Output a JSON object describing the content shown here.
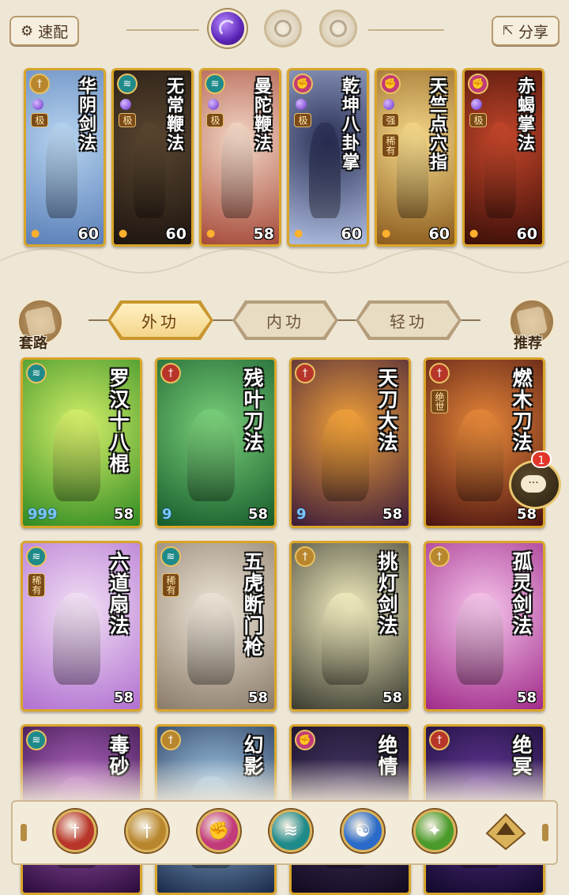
{
  "top_bar": {
    "quick_label": "速配",
    "share_label": "分享"
  },
  "equipped": [
    {
      "title": "华阴剑法",
      "level": "60",
      "grade": "极",
      "bg": [
        "#b7d4f0",
        "#5a7fb8"
      ],
      "school_color": "#b8862c",
      "school_glyph": "†"
    },
    {
      "title": "无常鞭法",
      "level": "60",
      "grade": "极",
      "bg": [
        "#5a4630",
        "#1e1510"
      ],
      "school_color": "#1f8a8a",
      "school_glyph": "≋"
    },
    {
      "title": "曼陀鞭法",
      "level": "58",
      "grade": "极",
      "bg": [
        "#f3d7c6",
        "#a64a3a"
      ],
      "school_color": "#1f8a8a",
      "school_glyph": "≋"
    },
    {
      "title": "乾坤八卦掌",
      "level": "60",
      "grade": "极",
      "bg": [
        "#2a2f55",
        "#aebde0"
      ],
      "school_color": "#c23a7a",
      "school_glyph": "✊"
    },
    {
      "title": "天竺点穴指",
      "level": "60",
      "grade": "强",
      "rarity": "稀有",
      "bg": [
        "#f6d98a",
        "#8a5a1c"
      ],
      "school_color": "#c23a7a",
      "school_glyph": "✊"
    },
    {
      "title": "赤蝎掌法",
      "level": "60",
      "grade": "极",
      "bg": [
        "#c4462a",
        "#3a0e08"
      ],
      "school_color": "#c23a7a",
      "school_glyph": "✊"
    }
  ],
  "tabs": {
    "waigong": "外功",
    "neigong": "内功",
    "qinggong": "轻功"
  },
  "side": {
    "taolu": "套路",
    "tuijian": "推荐"
  },
  "chat": {
    "badge": "1",
    "dots": "···"
  },
  "cards": [
    {
      "title": "罗汉十八棍",
      "level": "58",
      "extra": "999",
      "bg": [
        "#d6f06a",
        "#2f8a22"
      ],
      "school_color": "#1f8a8a",
      "school_glyph": "≋"
    },
    {
      "title": "残叶刀法",
      "level": "58",
      "extra": "9",
      "bg": [
        "#7ad07a",
        "#155a2a"
      ],
      "school_color": "#b8352a",
      "school_glyph": "†"
    },
    {
      "title": "天刀大法",
      "level": "58",
      "extra": "9",
      "bg": [
        "#f3a23a",
        "#3a1a3a"
      ],
      "school_color": "#b8352a",
      "school_glyph": "†"
    },
    {
      "title": "燃木刀法",
      "level": "58",
      "rarity": "绝世",
      "bg": [
        "#e8883a",
        "#4a1210"
      ],
      "school_color": "#b8352a",
      "school_glyph": "†"
    },
    {
      "title": "六道扇法",
      "level": "58",
      "rarity": "稀有",
      "bg": [
        "#f3e0f5",
        "#b070d0"
      ],
      "school_color": "#1f8a8a",
      "school_glyph": "≋"
    },
    {
      "title": "五虎断门枪",
      "level": "58",
      "rarity": "稀有",
      "bg": [
        "#eee6d8",
        "#8a7a68"
      ],
      "school_color": "#1f8a8a",
      "school_glyph": "≋"
    },
    {
      "title": "挑灯剑法",
      "level": "58",
      "bg": [
        "#f3eec0",
        "#3a3a30"
      ],
      "school_color": "#b8862c",
      "school_glyph": "†"
    },
    {
      "title": "孤灵剑法",
      "level": "58",
      "bg": [
        "#f5c4ea",
        "#a02a8a"
      ],
      "school_color": "#b8862c",
      "school_glyph": "†"
    },
    {
      "title": "毒砂",
      "level": "",
      "bg": [
        "#c070d0",
        "#2a0a3a"
      ],
      "school_color": "#1f8a8a",
      "school_glyph": "≋"
    },
    {
      "title": "幻影",
      "level": "",
      "bg": [
        "#a8d0f0",
        "#1a2a4a"
      ],
      "school_color": "#b8862c",
      "school_glyph": "†"
    },
    {
      "title": "绝情",
      "level": "",
      "bg": [
        "#4a3a6a",
        "#120a20"
      ],
      "school_color": "#c23a7a",
      "school_glyph": "✊"
    },
    {
      "title": "绝冥",
      "level": "",
      "bg": [
        "#6a3aa0",
        "#10082a"
      ],
      "school_color": "#b8352a",
      "school_glyph": "†"
    }
  ],
  "filters": [
    {
      "name": "sword",
      "color": "#b8352a",
      "glyph": "†"
    },
    {
      "name": "blade",
      "color": "#b8862c",
      "glyph": "†"
    },
    {
      "name": "fist",
      "color": "#c23a7a",
      "glyph": "✊"
    },
    {
      "name": "fan",
      "color": "#1f8a8a",
      "glyph": "≋"
    },
    {
      "name": "taiji",
      "color": "#2a6ac8",
      "glyph": "☯"
    },
    {
      "name": "staff",
      "color": "#4a9a2a",
      "glyph": "✦"
    }
  ]
}
